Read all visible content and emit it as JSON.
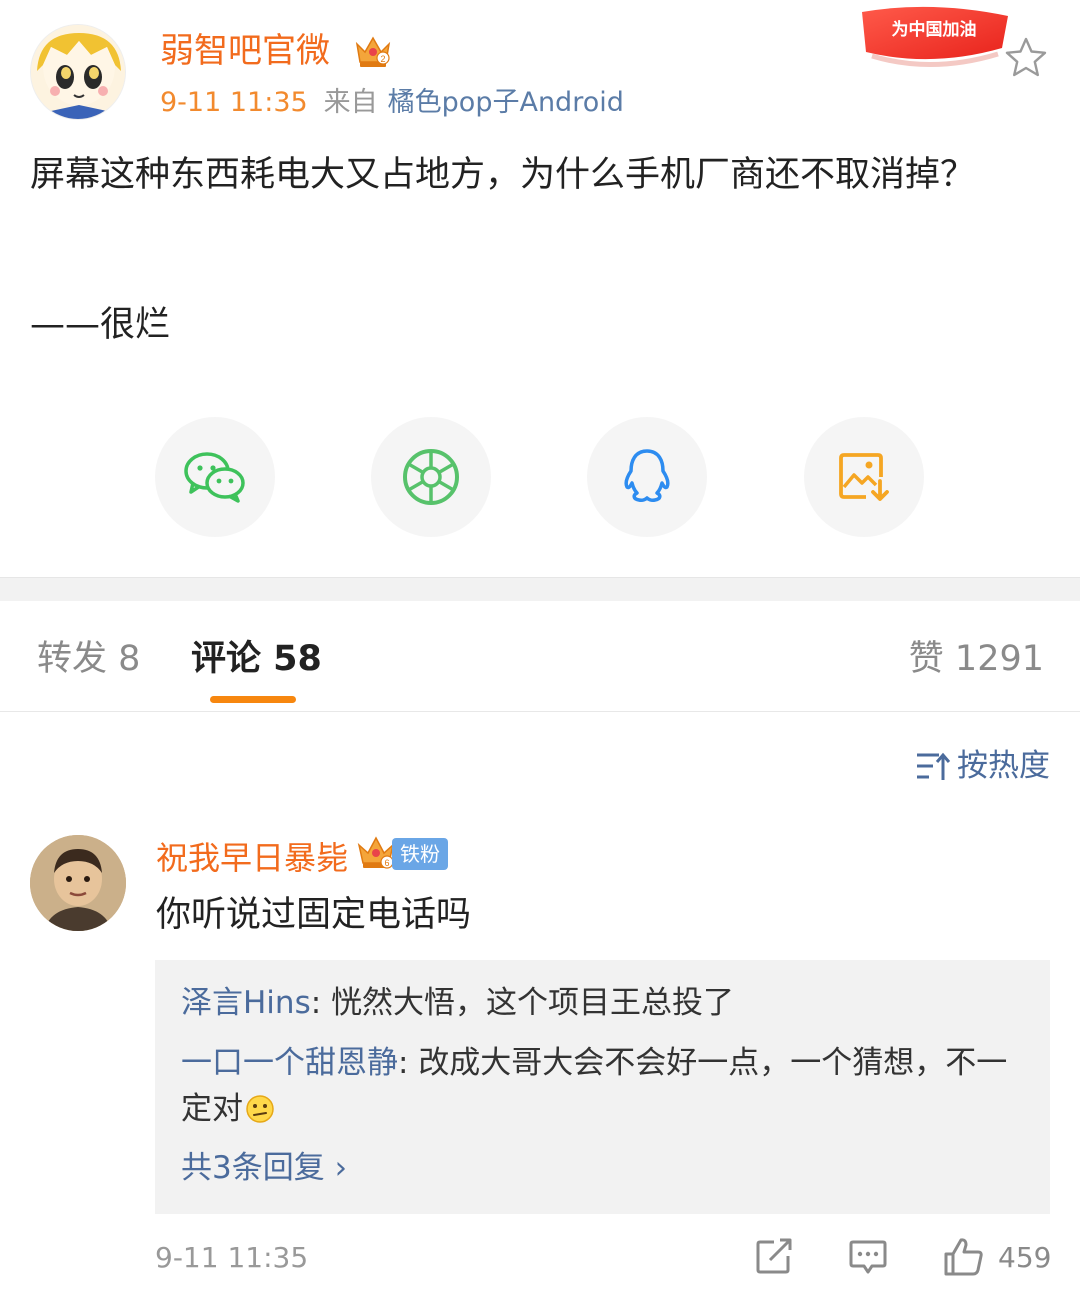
{
  "post": {
    "author": "弱智吧官微",
    "time": "9-11 11:35",
    "from_label": "来自",
    "source": "橘色pop子Android",
    "event_badge": "为中国加油",
    "text": "屏幕这种东西耗电大又占地方，为什么手机厂商还不取消掉？",
    "signature": "——很烂",
    "accent_color": "#f26b1d"
  },
  "share": [
    "wechat-icon",
    "moments-icon",
    "qq-icon",
    "save-image-icon"
  ],
  "tabs": {
    "repost": "转发 8",
    "comment": "评论 58",
    "like": "赞 1291",
    "underline_color": "#f7870f"
  },
  "sort": {
    "label": "按热度"
  },
  "comment": {
    "author": "祝我早日暴毙",
    "fan_badge": "铁粉",
    "text": "你听说过固定电话吗",
    "replies": [
      {
        "author": "泽言Hins",
        "text": "恍然大悟，这个项目王总投了"
      },
      {
        "author": "一口一个甜恩静",
        "text": "改成大哥大会不会好一点，一个猜想，不一定对"
      }
    ],
    "more_replies": "共3条回复 ›",
    "time": "9-11 11:35",
    "likes": "459",
    "link_color": "#4b6b9c"
  }
}
